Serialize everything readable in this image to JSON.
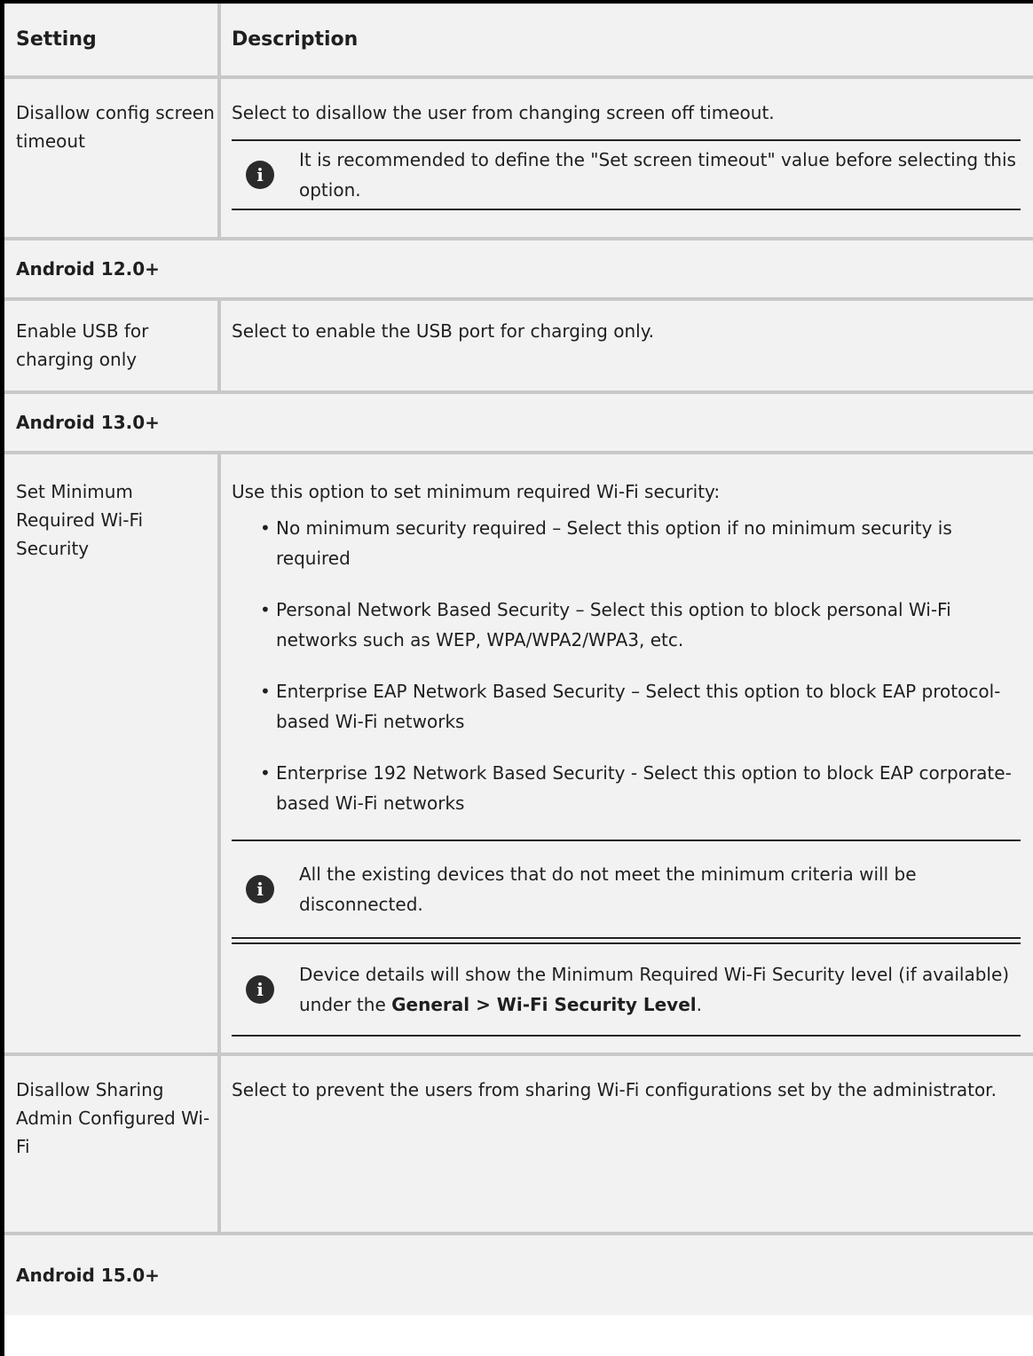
{
  "table": {
    "headers": {
      "setting": "Setting",
      "description": "Description"
    },
    "rows": {
      "screen_timeout": {
        "label": "Disallow config screen timeout",
        "description": "Select to disallow the user from changing screen off timeout.",
        "note": "It is recommended to define the \"Set screen timeout\" value before selecting this option."
      },
      "android12_section": "Android 12.0+",
      "usb_charging": {
        "label": "Enable USB for charging only",
        "description": "Select to enable the USB port for charging only."
      },
      "android13_section": "Android 13.0+",
      "wifi_security": {
        "label": "Set Minimum Required Wi-Fi Security",
        "description": "Use this option to set minimum required Wi-Fi security:",
        "options": [
          "No minimum security required – Select this option if no minimum security is required",
          "Personal Network Based Security – Select this option to block personal Wi-Fi networks such as WEP, WPA/WPA2/WPA3, etc.",
          "Enterprise EAP Network Based Security – Select this option to block EAP protocol-based Wi-Fi networks",
          "Enterprise 192 Network Based Security - Select this option to block EAP corporate-based Wi-Fi networks"
        ],
        "note1": "All the existing devices that do not meet the minimum criteria will be disconnected.",
        "note2_prefix": "Device details will show the Minimum Required Wi-Fi Security level (if available) under the ",
        "note2_bold": "General > Wi-Fi Security Level",
        "note2_suffix": "."
      },
      "sharing_wifi": {
        "label": "Disallow Sharing Admin Configured Wi-Fi",
        "description": "Select to prevent the users from sharing Wi-Fi configurations set by the administrator."
      },
      "android15_section": "Android 15.0+"
    }
  },
  "icons": {
    "note_icon": "info-icon",
    "note_icon_glyph": "i"
  }
}
